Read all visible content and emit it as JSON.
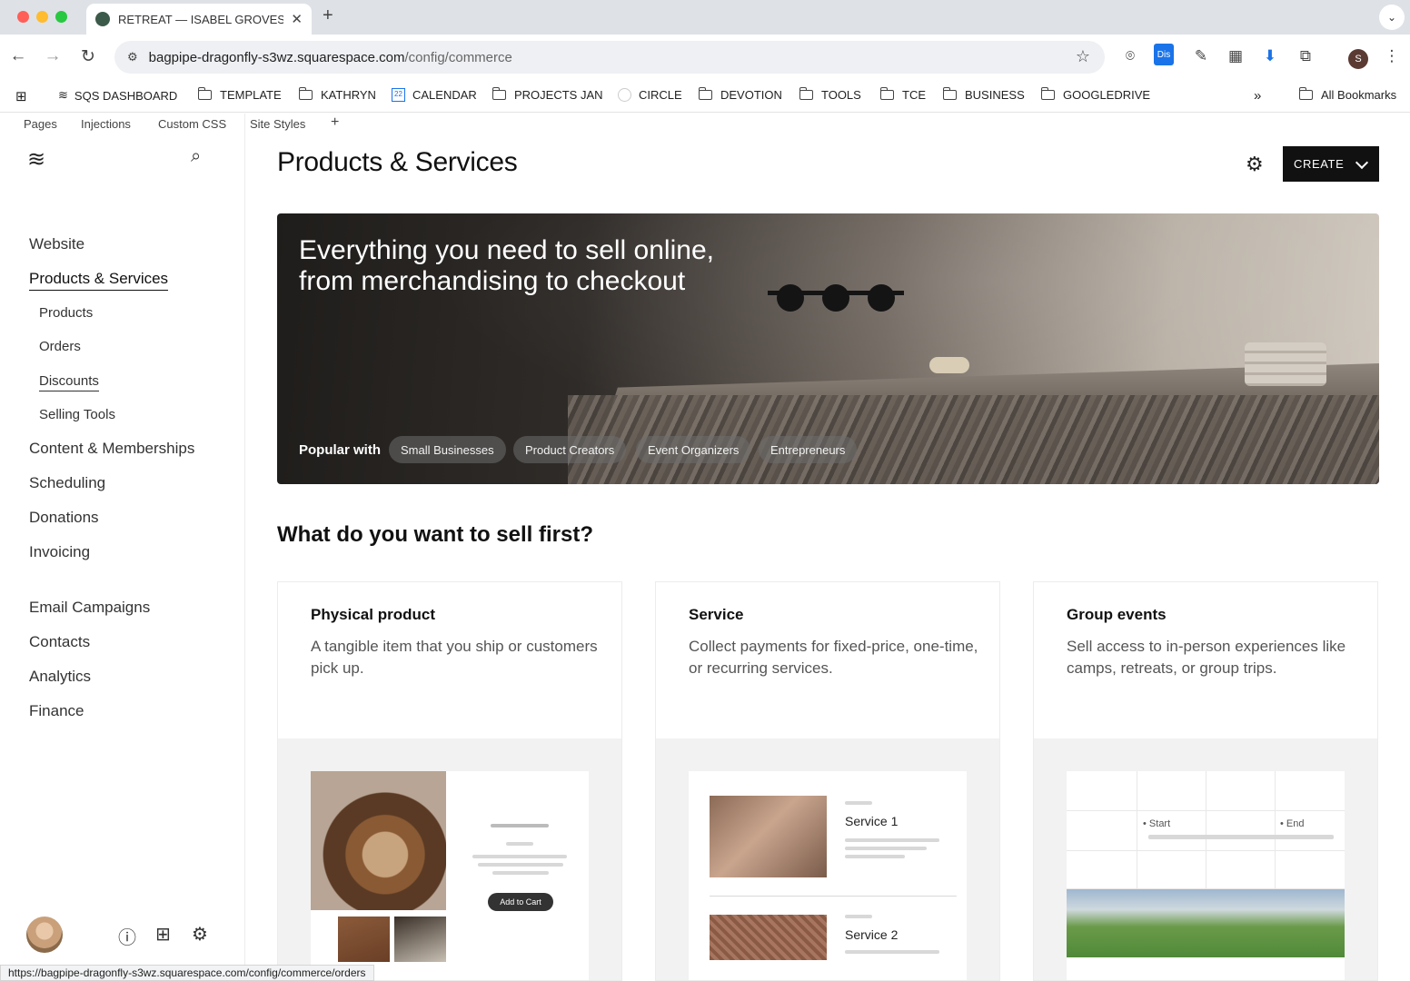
{
  "browser": {
    "tab_title": "RETREAT — ISABEL GROVES",
    "url_host": "bagpipe-dragonfly-s3wz.squarespace.com",
    "url_path": "/config/commerce",
    "profile_initial": "S",
    "ext_badge": "Dis",
    "bookmarks": [
      {
        "label": "SQS DASHBOARD",
        "icon": "squarespace-icon"
      },
      {
        "label": "TEMPLATE",
        "icon": "folder-icon"
      },
      {
        "label": "KATHRYN",
        "icon": "folder-icon"
      },
      {
        "label": "CALENDAR",
        "icon": "calendar-icon"
      },
      {
        "label": "PROJECTS JAN",
        "icon": "folder-icon"
      },
      {
        "label": "CIRCLE",
        "icon": "circle-icon"
      },
      {
        "label": "DEVOTION",
        "icon": "folder-icon"
      },
      {
        "label": "TOOLS",
        "icon": "folder-icon"
      },
      {
        "label": "TCE",
        "icon": "folder-icon"
      },
      {
        "label": "BUSINESS",
        "icon": "folder-icon"
      },
      {
        "label": "GOOGLEDRIVE",
        "icon": "folder-icon"
      }
    ],
    "all_bookmarks": "All Bookmarks",
    "status_url": "https://bagpipe-dragonfly-s3wz.squarespace.com/config/commerce/orders"
  },
  "topnav": [
    "Pages",
    "Injections",
    "Custom CSS",
    "Site Styles"
  ],
  "sidebar": {
    "items": [
      {
        "label": "Website"
      },
      {
        "label": "Products & Services",
        "active": true
      },
      {
        "label": "Products",
        "sub": true
      },
      {
        "label": "Orders",
        "sub": true
      },
      {
        "label": "Discounts",
        "sub": true
      },
      {
        "label": "Selling Tools",
        "sub": true
      },
      {
        "label": "Content & Memberships"
      },
      {
        "label": "Scheduling"
      },
      {
        "label": "Donations"
      },
      {
        "label": "Invoicing"
      },
      {
        "label": "Email Campaigns"
      },
      {
        "label": "Contacts"
      },
      {
        "label": "Analytics"
      },
      {
        "label": "Finance"
      }
    ]
  },
  "main": {
    "title": "Products & Services",
    "create_label": "CREATE",
    "hero": {
      "title": "Everything you need to sell online, from merchandising to checkout",
      "popular_label": "Popular with",
      "chips": [
        "Small Businesses",
        "Product Creators",
        "Event Organizers",
        "Entrepreneurs"
      ]
    },
    "question": "What do you want to sell first?",
    "cards": [
      {
        "title": "Physical product",
        "desc": "A tangible item that you ship or customers pick up.",
        "preview_button": "Add to Cart"
      },
      {
        "title": "Service",
        "desc": "Collect payments for fixed-price, one-time, or recurring services.",
        "preview_labels": [
          "Service 1",
          "Service 2"
        ]
      },
      {
        "title": "Group events",
        "desc": "Sell access to in-person experiences like camps, retreats, or group trips.",
        "preview_labels": [
          "Start",
          "End"
        ]
      }
    ]
  },
  "colors": {
    "accent": "#111111",
    "chrome": "#dee1e6",
    "omnibox": "#eef0f3"
  }
}
